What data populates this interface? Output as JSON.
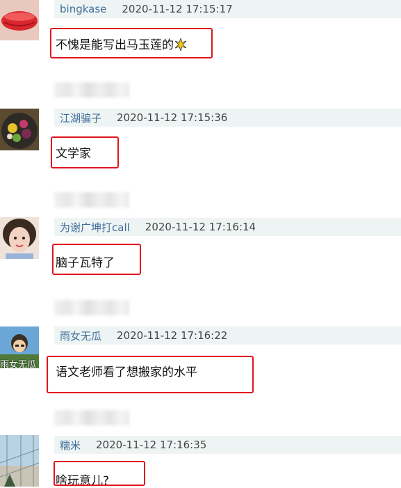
{
  "comments": [
    {
      "user": "bingkase",
      "time": "2020-11-12 17:15:17",
      "text": "不愧是能写出马玉莲的",
      "emoji": "sparkle-burst"
    },
    {
      "user": "江湖骗子",
      "time": "2020-11-12 17:15:36",
      "text": "文学家"
    },
    {
      "user": "为谢广坤打call",
      "time": "2020-11-12 17:16:14",
      "text": "脑子瓦特了"
    },
    {
      "user": "雨女无瓜",
      "time": "2020-11-12 17:16:22",
      "text": "语文老师看了想搬家的水平",
      "avatar_text": "雨女无瓜"
    },
    {
      "user": "糯米",
      "time": "2020-11-12 17:16:35",
      "text": "啥玩意儿?"
    }
  ],
  "colors": {
    "highlight": "#e1141d",
    "username": "#3f6e9a",
    "header_bg": "#eef4f4"
  }
}
